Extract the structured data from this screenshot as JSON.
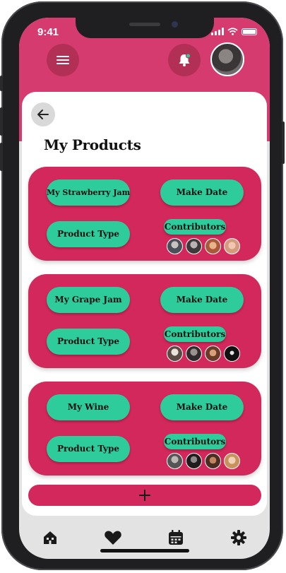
{
  "status_bar": {
    "time": "9:41"
  },
  "page": {
    "title": "My Products"
  },
  "colors": {
    "brand": "#d53b6e",
    "card": "#d3285b",
    "accent": "#2ecc9b"
  },
  "header": {
    "menu_icon": "menu-icon",
    "bell_icon": "bell-icon"
  },
  "products": [
    {
      "name": "My Strawberry Jam",
      "type_label": "Product Type",
      "date_label": "Make Date",
      "contributors_label": "Contributors"
    },
    {
      "name": "My Grape Jam",
      "type_label": "Product Type",
      "date_label": "Make Date",
      "contributors_label": "Contributors"
    },
    {
      "name": "My Wine",
      "type_label": "Product Type",
      "date_label": "Make Date",
      "contributors_label": "Contributors"
    }
  ],
  "add_button": {
    "icon": "plus-icon"
  },
  "tabbar": {
    "items": [
      "home-icon",
      "heart-icon",
      "calendar-icon",
      "gear-icon"
    ]
  }
}
